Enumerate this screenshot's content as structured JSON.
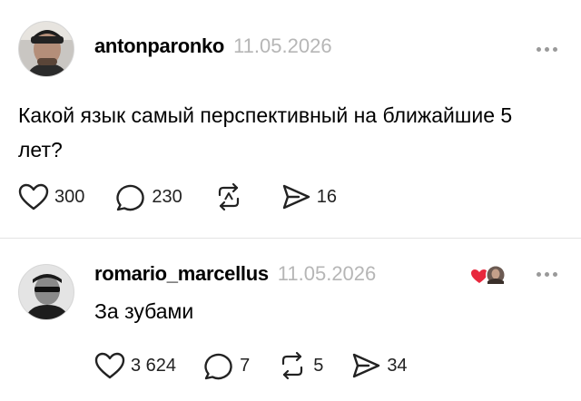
{
  "posts": [
    {
      "username": "antonparonko",
      "date": "11.05.2026",
      "text": "Какой язык самый перспективный на ближайшие 5 лет?",
      "likes": "300",
      "replies": "230",
      "reposts": "",
      "shares": "16"
    },
    {
      "username": "romario_marcellus",
      "date": "11.05.2026",
      "text": "За зубами",
      "likes": "3 624",
      "replies": "7",
      "reposts": "5",
      "shares": "34"
    }
  ],
  "icons": {
    "like": "heart-icon",
    "reply": "speech-bubble-icon",
    "repost": "repost-icon",
    "share": "send-icon",
    "more": "more-dots-icon",
    "reaction": "heart-with-avatar-icon"
  },
  "colors": {
    "date": "#b6b6b6",
    "divider": "#e3e3e3",
    "reaction_heart": "#e8283d"
  }
}
